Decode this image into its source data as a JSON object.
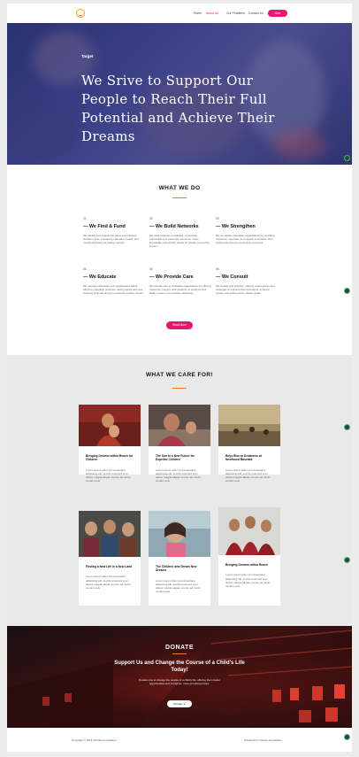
{
  "header": {
    "nav": [
      "Home",
      "About Us",
      "Our Problems",
      "Contact Us"
    ],
    "active_nav": "About Us",
    "donate_label": "Give"
  },
  "hero": {
    "tag": "Target",
    "title": "We Srive to Support Our People to Reach Their Full Potential and Achieve Their Dreams"
  },
  "what_we_do": {
    "title": "WHAT WE DO",
    "items": [
      {
        "num": "01",
        "title": "— We Find & Fund",
        "desc": "We identify and support the latest and enhance children's lives, prioritizing education, health, and overall well-being for lasting impacts."
      },
      {
        "num": "02",
        "title": "— We Build Networks",
        "desc": "We build networks of charities, connecting organizations to maximize resources, share knowledge, and amplify efforts for greater community impact."
      },
      {
        "num": "03",
        "title": "— We Strengthen",
        "desc": "We strengthen charitable organizations by providing resources, expertise, and support to enhance their impact and improve community outcomes."
      },
      {
        "num": "04",
        "title": "— We Educate",
        "desc": "We educate individuals and organizations about effective charitable practices, raising awareness and fostering informed giving to maximize positive impact."
      },
      {
        "num": "05",
        "title": "— We Provide Care",
        "desc": "We provide care to charitable organizations by offering resources, support, and guidance to enhance their ability to serve communities effectively."
      },
      {
        "num": "06",
        "title": "— We Consult",
        "desc": "We consult with charities, offering expert advice and strategies to optimize their operations, enhance impact, and achieve their mission goals."
      }
    ],
    "read_more": "Read More"
  },
  "care": {
    "title": "WHAT WE CARE FOR!",
    "cards": [
      {
        "title": "Bringing Dreams within Reach for Children",
        "desc": "Lorem ipsum dolor sit consectetur adipiscing elit, sed do eiusmod ut et dolore magna aliqua ut enim ad minim veniam quis"
      },
      {
        "title": "The Sun to a New Future for Expelled Children",
        "desc": "Lorem ipsum dolor sit consectetur adipiscing elit, sed do eiusmod ut et dolore magna aliqua ut enim ad minim veniam quis"
      },
      {
        "title": "Boys Rise to Greatness at Newfound Baseball",
        "desc": "Lorem ipsum dolor sit consectetur adipiscing elit, sed do eiusmod ut et dolore magna aliqua ut enim ad minim veniam quis"
      },
      {
        "title": "Finding a New Life in a New Land",
        "desc": "Lorem ipsum dolor sit consectetur adipiscing elit, sed do eiusmod ut et dolore magna aliqua ut enim ad minim veniam quis"
      },
      {
        "title": "The Children who Dream New Dreams",
        "desc": "Lorem ipsum dolor sit consectetur adipiscing elit, sed do eiusmod ut et dolore magna aliqua ut enim ad minim veniam quis"
      },
      {
        "title": "Bringing Dreams within Reach",
        "desc": "Lorem ipsum dolor sit consectetur adipiscing elit, sed do eiusmod ut et dolore magna aliqua ut enim ad minim veniam quis"
      }
    ]
  },
  "donate": {
    "title": "DONATE",
    "subtitle": "Support Us and Change the Course of a Child's Life Today!",
    "text": "Donate now to change the course of a child's life, offering them better opportunities and a brighter, more promising future.",
    "button": "Donate ➜"
  },
  "footer": {
    "copyright": "Copyright © 2024 Charles Foundation",
    "powered": "Powered by Charles Foundation"
  },
  "colors": {
    "accent_pink": "#e8166e",
    "accent_orange": "#f07a22",
    "hero_blue": "#2f3578",
    "side_dot_green": "#1e4d3a"
  }
}
